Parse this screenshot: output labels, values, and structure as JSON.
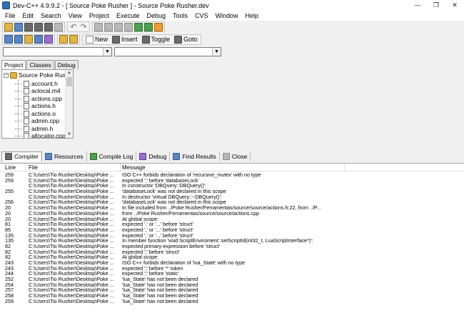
{
  "window": {
    "title": "Dev-C++ 4.9.9.2  - [ Source Poke Rusher ] - Source Poke Rusher.dev",
    "minimize": "—",
    "maximize": "❐",
    "close": "✕"
  },
  "menu": [
    "File",
    "Edit",
    "Search",
    "View",
    "Project",
    "Execute",
    "Debug",
    "Tools",
    "CVS",
    "Window",
    "Help"
  ],
  "toolbar2": {
    "new_label": "New",
    "insert_label": "Insert",
    "toggle_label": "Toggle",
    "goto_label": "Goto"
  },
  "project_tabs": [
    "Project",
    "Classes",
    "Debug"
  ],
  "tree": {
    "root": "Source Poke Rusher",
    "files": [
      "account.h",
      "aclocal.m4",
      "actions.cpp",
      "actions.h",
      "actions.o",
      "admin.cpp",
      "admin.h",
      "allocator.cpp"
    ]
  },
  "bottom_tabs": [
    "Compiler",
    "Resources",
    "Compile Log",
    "Debug",
    "Find Results",
    "Close"
  ],
  "log": {
    "columns": [
      "Line",
      "File",
      "Message"
    ],
    "rows": [
      {
        "line": "259",
        "file": "C:\\Users\\Tio Rusher\\Desktop\\Poke ...",
        "msg": "ISO C++ forbids declaration of 'recursive_mutex' with no type"
      },
      {
        "line": "259",
        "file": "C:\\Users\\Tio Rusher\\Desktop\\Poke ...",
        "msg": "expected ';' before 'databaseLock'"
      },
      {
        "line": "",
        "file": "C:\\Users\\Tio Rusher\\Desktop\\Poke ...",
        "msg": "In constructor 'DBQuery::DBQuery()':"
      },
      {
        "line": "255",
        "file": "C:\\Users\\Tio Rusher\\Desktop\\Poke ...",
        "msg": "'databaseLock' was not declared in this scope"
      },
      {
        "line": "",
        "file": "C:\\Users\\Tio Rusher\\Desktop\\Poke ...",
        "msg": "In destructor 'virtual DBQuery::~DBQuery()':"
      },
      {
        "line": "256",
        "file": "C:\\Users\\Tio Rusher\\Desktop\\Poke ...",
        "msg": "'databaseLock' was not declared in this scope"
      },
      {
        "line": "20",
        "file": "C:\\Users\\Tio Rusher\\Desktop\\Poke ...",
        "msg": "In file included from ../Poke Rusher/Ferramentas/source/source/actions.h:22,                    from ../P..."
      },
      {
        "line": "20",
        "file": "C:\\Users\\Tio Rusher\\Desktop\\Poke ...",
        "msg": "                 from ../Poke Rusher/Ferramentas/source/source/actions.cpp"
      },
      {
        "line": "20",
        "file": "C:\\Users\\Tio Rusher\\Desktop\\Poke ...",
        "msg": "At global scope:"
      },
      {
        "line": "81",
        "file": "C:\\Users\\Tio Rusher\\Desktop\\Poke ...",
        "msg": "expected ',' or '...' before 'struct'"
      },
      {
        "line": "85",
        "file": "C:\\Users\\Tio Rusher\\Desktop\\Poke ...",
        "msg": "expected ',' or '...' before 'struct'"
      },
      {
        "line": "135",
        "file": "C:\\Users\\Tio Rusher\\Desktop\\Poke ...",
        "msg": "expected ',' or '...' before 'struct'"
      },
      {
        "line": "135",
        "file": "C:\\Users\\Tio Rusher\\Desktop\\Poke ...",
        "msg": "In member function 'void ScriptEnviroment::setScriptId(int32_t, LuaScriptInterface*)':"
      },
      {
        "line": "82",
        "file": "C:\\Users\\Tio Rusher\\Desktop\\Poke ...",
        "msg": "expected primary-expression before 'struct'"
      },
      {
        "line": "82",
        "file": "C:\\Users\\Tio Rusher\\Desktop\\Poke ...",
        "msg": "expected ';' before 'struct'"
      },
      {
        "line": "82",
        "file": "C:\\Users\\Tio Rusher\\Desktop\\Poke ...",
        "msg": "At global scope:"
      },
      {
        "line": "243",
        "file": "C:\\Users\\Tio Rusher\\Desktop\\Poke ...",
        "msg": "ISO C++ forbids declaration of 'lua_State' with no type"
      },
      {
        "line": "243",
        "file": "C:\\Users\\Tio Rusher\\Desktop\\Poke ...",
        "msg": "expected ';' before '*' token"
      },
      {
        "line": "244",
        "file": "C:\\Users\\Tio Rusher\\Desktop\\Poke ...",
        "msg": "expected ';' before 'static'"
      },
      {
        "line": "252",
        "file": "C:\\Users\\Tio Rusher\\Desktop\\Poke ...",
        "msg": "'lua_State' has not been declared"
      },
      {
        "line": "254",
        "file": "C:\\Users\\Tio Rusher\\Desktop\\Poke ...",
        "msg": "'lua_State' has not been declared"
      },
      {
        "line": "257",
        "file": "C:\\Users\\Tio Rusher\\Desktop\\Poke ...",
        "msg": "'lua_State' has not been declared"
      },
      {
        "line": "258",
        "file": "C:\\Users\\Tio Rusher\\Desktop\\Poke ...",
        "msg": "'lua_State' has not been declared"
      },
      {
        "line": "259",
        "file": "C:\\Users\\Tio Rusher\\Desktop\\Poke ...",
        "msg": "'lua_State' has not been declared"
      }
    ]
  }
}
